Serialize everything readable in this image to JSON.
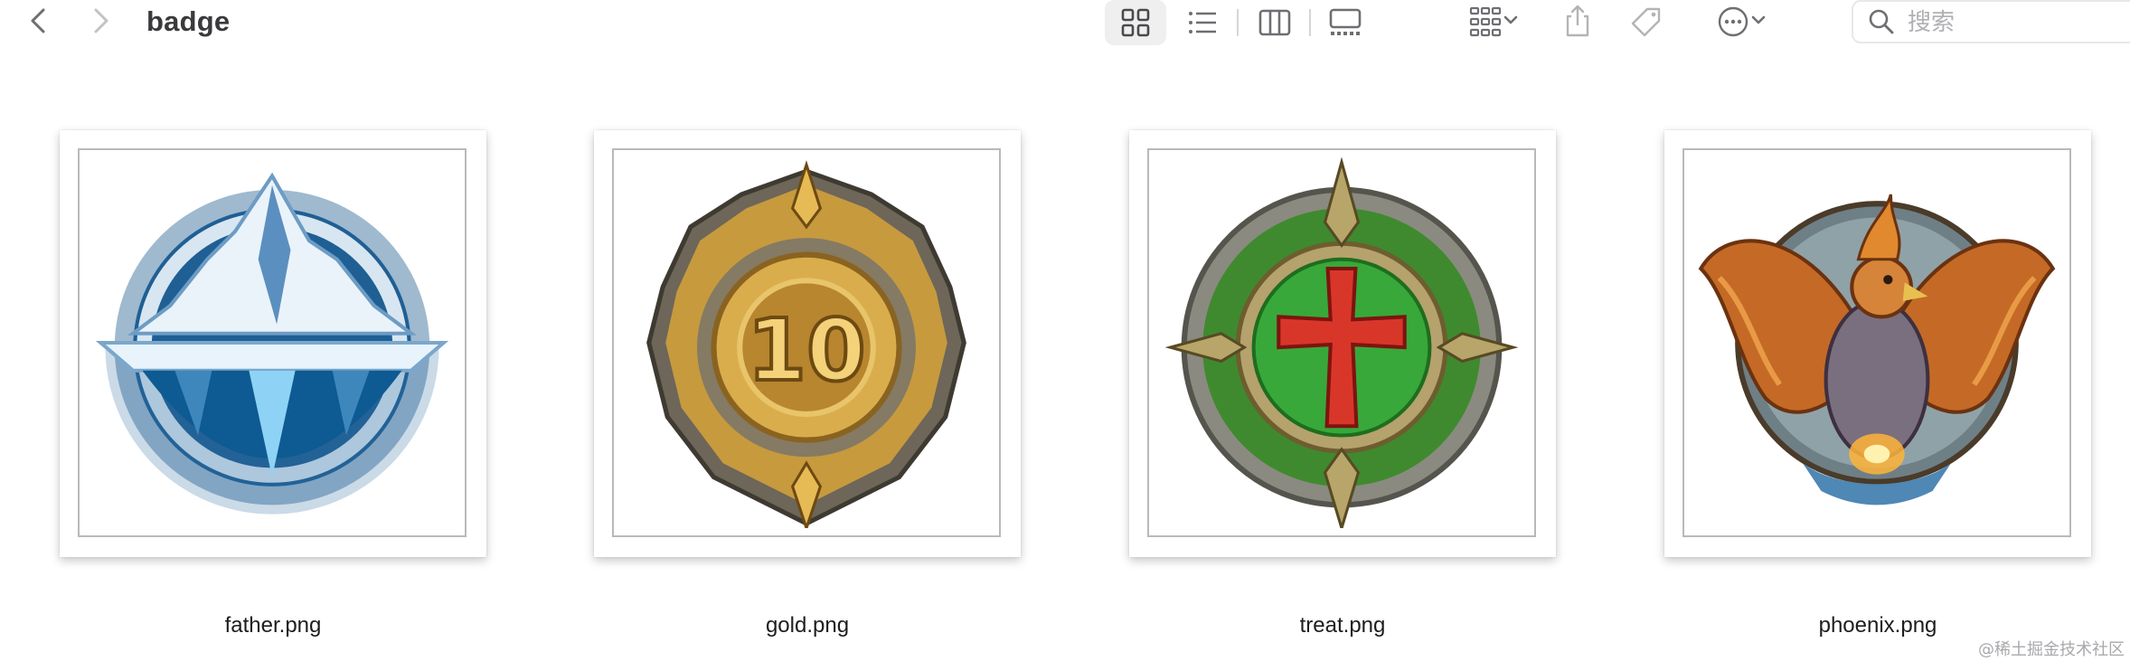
{
  "window": {
    "title": "badge"
  },
  "toolbar": {
    "nav": [
      {
        "name": "back",
        "icon": "chevron-left-icon"
      },
      {
        "name": "forward",
        "icon": "chevron-right-icon"
      }
    ],
    "view_modes": [
      {
        "icon": "icon-grid-icon",
        "active": true
      },
      {
        "icon": "list-view-icon",
        "active": false
      },
      {
        "icon": "column-view-icon",
        "active": false
      },
      {
        "icon": "gallery-view-icon",
        "active": false
      }
    ],
    "actions": [
      "group-by-icon",
      "share-icon",
      "tag-icon",
      "more-actions-icon"
    ]
  },
  "search": {
    "placeholder": "搜索",
    "value": ""
  },
  "files": [
    {
      "name": "father.png",
      "depicts": "ice-mountain-badge"
    },
    {
      "name": "gold.png",
      "depicts": "gold-10-medal"
    },
    {
      "name": "treat.png",
      "depicts": "green-cross-shield"
    },
    {
      "name": "phoenix.png",
      "depicts": "phoenix-emblem"
    }
  ],
  "watermark": "@稀土掘金技术社区",
  "colors": {
    "accent": "#1d1d1f",
    "toolbar_icon": "#6e6e73",
    "selected_bg": "#efeff0"
  }
}
